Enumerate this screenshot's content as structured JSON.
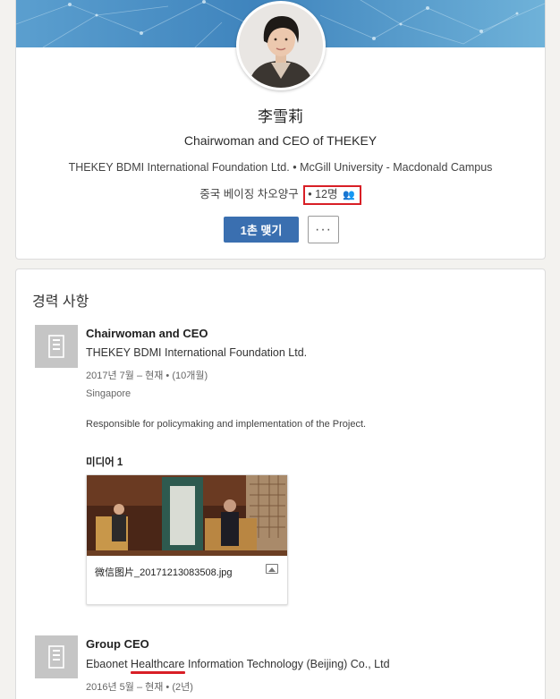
{
  "profile": {
    "name": "李雪莉",
    "headline": "Chairwoman and CEO of THEKEY",
    "current_company": "THEKEY BDMI International Foundation Ltd.",
    "school": "McGill University - Macdonald Campus",
    "location": "중국 베이징 차오양구",
    "connections": "12명",
    "connect_button": "1촌 맺기",
    "more_button": "···",
    "separator": "•"
  },
  "experience": {
    "section_title": "경력 사항",
    "items": [
      {
        "title": "Chairwoman and CEO",
        "company": "THEKEY BDMI International Foundation Ltd.",
        "date_range": "2017년 7월 – 현재",
        "duration": "(10개월)",
        "location": "Singapore",
        "description": "Responsible for policymaking and implementation of the Project.",
        "media_label": "미디어 1",
        "media_filename": "微信图片_20171213083508.jpg"
      },
      {
        "title": "Group CEO",
        "company_before": "Ebaonet ",
        "company_highlight": "Healthcare",
        "company_after": " Information Technology (Beijing) Co., Ltd",
        "date_range": "2016년 5월 – 현재",
        "duration": "(2년)"
      }
    ]
  },
  "icons": {
    "connections": "people-icon",
    "company_logo": "building-icon",
    "media_type": "image-icon"
  },
  "colors": {
    "accent": "#3a6fb0",
    "highlight_box": "#d81f26",
    "logo_tile": "#c5c5c5"
  }
}
